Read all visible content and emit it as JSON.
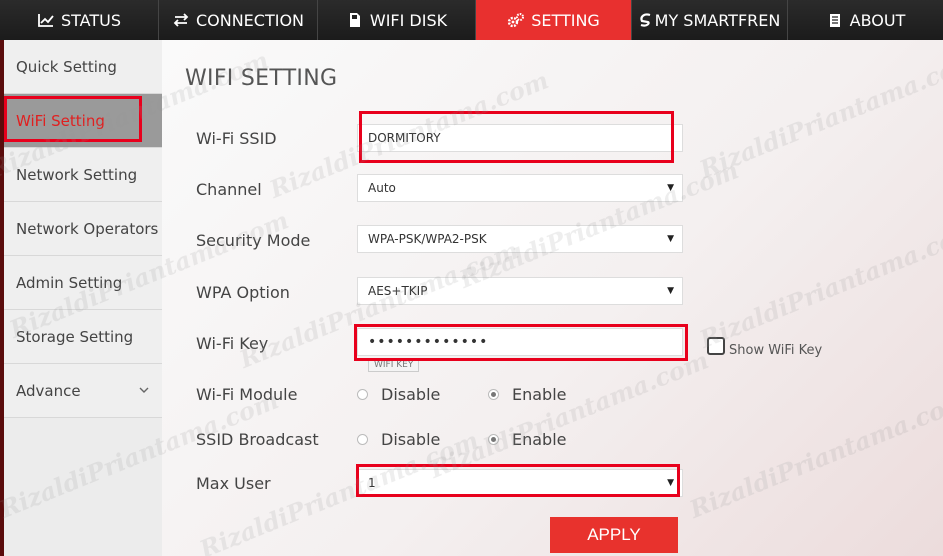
{
  "nav": {
    "tabs": [
      {
        "label": "STATUS",
        "icon": "line-chart-icon"
      },
      {
        "label": "CONNECTION",
        "icon": "exchange-arrows-icon"
      },
      {
        "label": "WIFI DISK",
        "icon": "sd-card-icon"
      },
      {
        "label": "SETTING",
        "icon": "gears-icon",
        "active": true
      },
      {
        "label": "MY SMARTFREN",
        "icon": "smartfren-logo-icon"
      },
      {
        "label": "ABOUT",
        "icon": "document-icon"
      }
    ]
  },
  "sidebar": {
    "items": [
      {
        "label": "Quick Setting"
      },
      {
        "label": "WiFi Setting",
        "active": true
      },
      {
        "label": "Network Setting"
      },
      {
        "label": "Network Operators"
      },
      {
        "label": "Admin Setting"
      },
      {
        "label": "Storage Setting"
      },
      {
        "label": "Advance",
        "icon": "chevron-down-icon"
      }
    ]
  },
  "main": {
    "title": "WIFI SETTING",
    "fields": {
      "ssid": {
        "label": "Wi-Fi SSID",
        "value": "DORMITORY"
      },
      "channel": {
        "label": "Channel",
        "value": "Auto"
      },
      "security_mode": {
        "label": "Security Mode",
        "value": "WPA-PSK/WPA2-PSK"
      },
      "wpa_option": {
        "label": "WPA Option",
        "value": "AES+TKIP"
      },
      "wifi_key": {
        "label": "Wi-Fi Key",
        "value": "•••••••••••••",
        "tooltip": "WIFI KEY",
        "show_label": "Show WiFi Key"
      },
      "wifi_module": {
        "label": "Wi-Fi Module",
        "options": [
          "Disable",
          "Enable"
        ],
        "selected": "Enable"
      },
      "ssid_broadcast": {
        "label": "SSID Broadcast",
        "options": [
          "Disable",
          "Enable"
        ],
        "selected": "Enable"
      },
      "max_user": {
        "label": "Max User",
        "value": "1"
      }
    },
    "apply_label": "APPLY"
  },
  "watermark": "RizaldiPriantama.com",
  "colors": {
    "accent": "#e8302f",
    "highlight_box": "#e8001c",
    "nav_bg": "#222222"
  }
}
